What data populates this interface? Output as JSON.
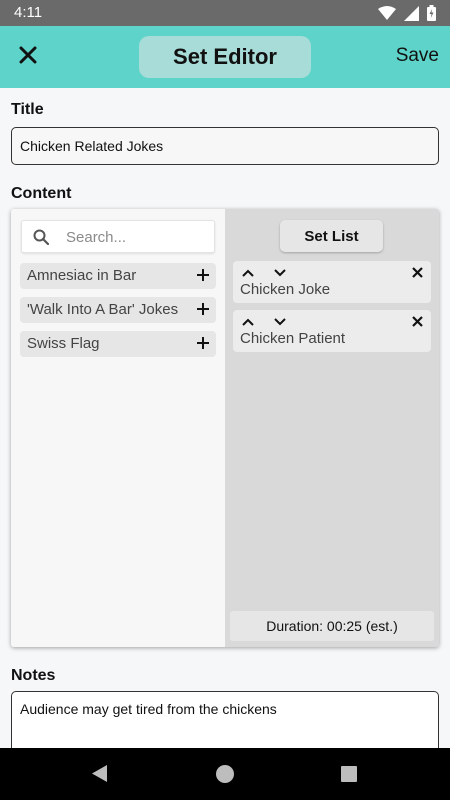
{
  "status_bar": {
    "time": "4:11",
    "icons": [
      "wifi-icon",
      "signal-icon",
      "battery-icon"
    ]
  },
  "app_bar": {
    "title": "Set Editor",
    "save_label": "Save",
    "close_icon": "close-icon",
    "color": "#5ed3c9"
  },
  "title_section": {
    "label": "Title",
    "value": "Chicken Related Jokes"
  },
  "content_section": {
    "label": "Content",
    "search": {
      "placeholder": "Search..."
    },
    "available_items": [
      {
        "label": "Amnesiac in Bar"
      },
      {
        "label": "'Walk Into A Bar' Jokes"
      },
      {
        "label": "Swiss Flag"
      }
    ],
    "set_list": {
      "button_label": "Set List",
      "items": [
        {
          "label": "Chicken Joke"
        },
        {
          "label": "Chicken Patient"
        }
      ],
      "duration": "Duration: 00:25 (est.)"
    }
  },
  "notes_section": {
    "label": "Notes",
    "value": "Audience may get tired from the chickens"
  },
  "nav_bar": {
    "icons": [
      "back-icon",
      "home-icon",
      "recents-icon"
    ]
  }
}
